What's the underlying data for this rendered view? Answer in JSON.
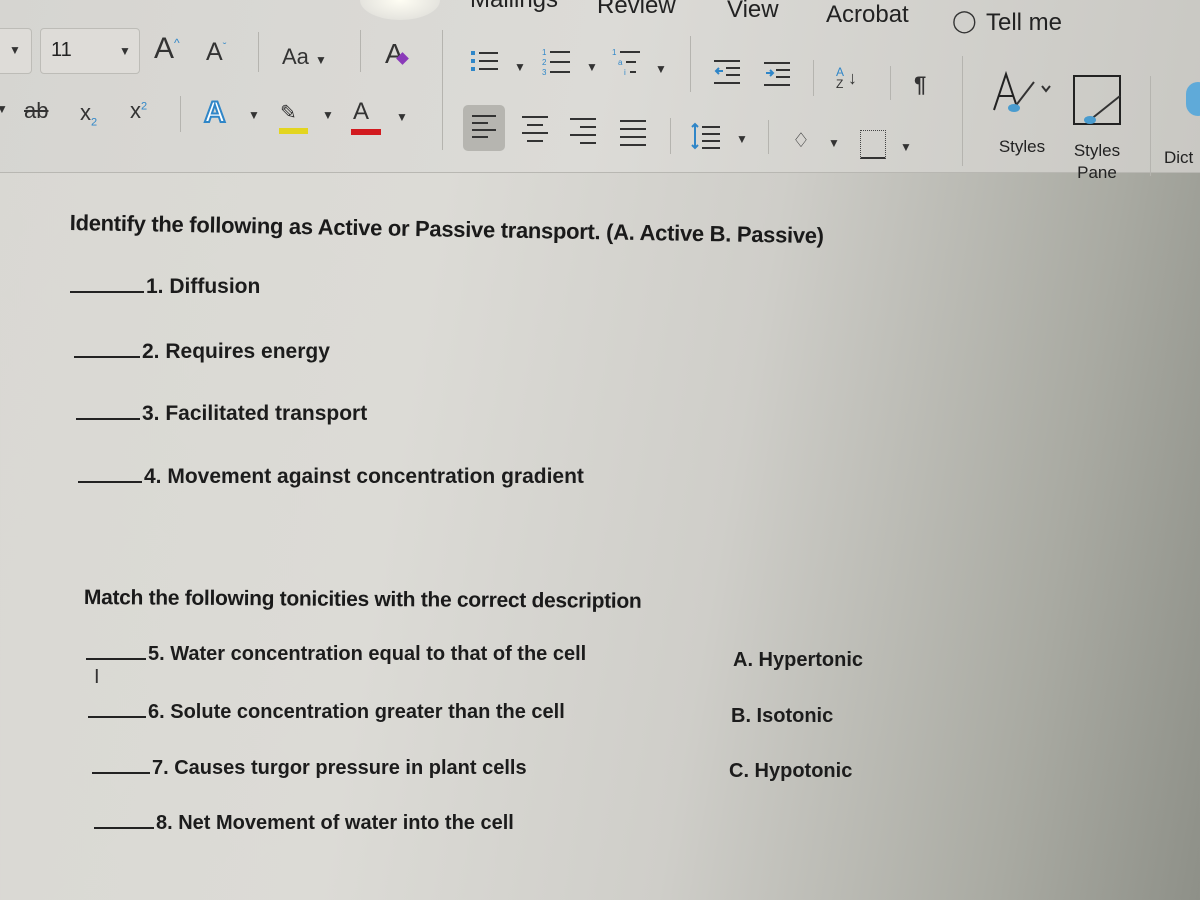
{
  "ribbon": {
    "tabs": [
      {
        "label": "Mailings"
      },
      {
        "label": "Review"
      },
      {
        "label": "View"
      },
      {
        "label": "Acrobat"
      }
    ],
    "tell_me": "Tell me",
    "font_size": "11",
    "change_case": "Aa",
    "styles_label": "Styles",
    "styles_pane_label_1": "Styles",
    "styles_pane_label_2": "Pane",
    "dictate_label": "Dict",
    "colors": {
      "highlight": "#e3d51f",
      "font_color": "#d21a1f",
      "accent_blue": "#2f86c8"
    }
  },
  "document": {
    "section1": {
      "heading": "Identify the following as Active or Passive transport. (A. Active B. Passive)",
      "items": [
        {
          "text": "1. Diffusion"
        },
        {
          "text": "2. Requires energy"
        },
        {
          "text": "3. Facilitated transport"
        },
        {
          "text": "4. Movement against concentration gradient"
        }
      ]
    },
    "section2": {
      "heading": "Match the following tonicities with the correct description",
      "items": [
        {
          "text": "5. Water concentration equal to that of the cell"
        },
        {
          "text": "6. Solute concentration greater than the cell"
        },
        {
          "text": "7. Causes turgor pressure in plant cells"
        },
        {
          "text": "8. Net Movement of water into the cell"
        }
      ],
      "options": [
        {
          "text": "A. Hypertonic"
        },
        {
          "text": "B. Isotonic"
        },
        {
          "text": "C. Hypotonic"
        }
      ]
    }
  }
}
